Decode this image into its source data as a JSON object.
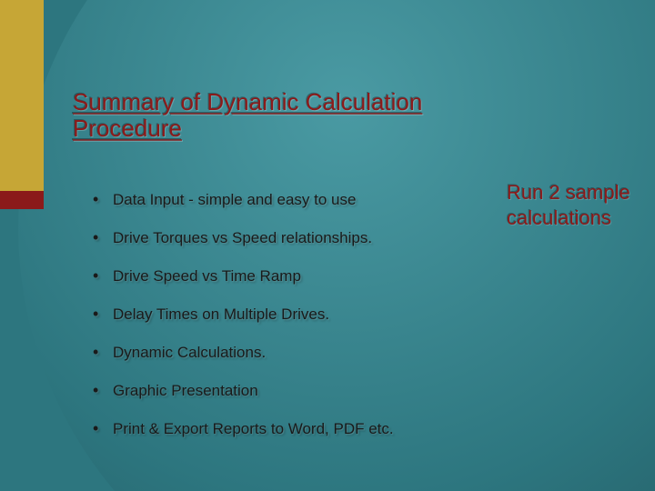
{
  "title": "Summary of Dynamic Calculation Procedure",
  "bullets": [
    "Data Input - simple and easy to use",
    "Drive Torques vs Speed relationships.",
    "Drive Speed vs Time Ramp",
    "Delay Times on Multiple Drives.",
    "Dynamic Calculations.",
    "Graphic Presentation",
    "Print & Export Reports to Word, PDF etc."
  ],
  "sidebar": "Run 2 sample calculations"
}
